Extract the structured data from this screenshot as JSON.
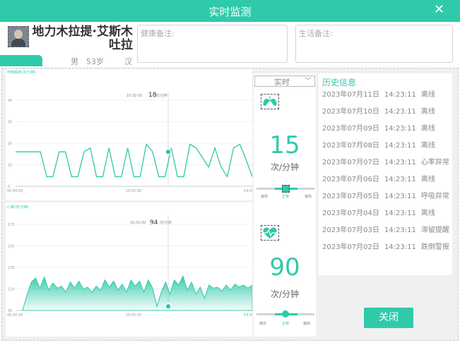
{
  "window": {
    "title": "实时监测"
  },
  "patient": {
    "name": "地力木拉提·艾斯木吐拉",
    "gender": "男",
    "age": "53岁",
    "ethnicity": "汉"
  },
  "notes": {
    "health_label": "健康备注:",
    "life_label": "生活备注:"
  },
  "respiration_chart": {
    "ylabel": "呼吸频率(次/分钟)",
    "y_ticks": [
      "40",
      "30",
      "20",
      "10",
      "0"
    ],
    "x_ticks": [
      "06:00:00",
      "10:00:00",
      "14:00:00"
    ],
    "tooltip_time": "10:32:00",
    "tooltip_value": "18",
    "tooltip_unit": "次/分钟"
  },
  "heart_chart": {
    "ylabel": "心率(次/分钟)",
    "y_ticks": [
      "170",
      "150",
      "130",
      "110",
      "90"
    ],
    "x_ticks": [
      "06:00:00",
      "10:00:00",
      "14:00:00"
    ],
    "tooltip_time": "10:32:00",
    "tooltip_value": "94",
    "tooltip_unit": "次/分钟"
  },
  "chart_data": [
    {
      "type": "line",
      "ylabel": "呼吸频率(次/分钟)",
      "ylim": [
        0,
        45
      ],
      "x": [
        "06:00:00",
        "10:00:00",
        "14:00:00"
      ],
      "values": [
        18,
        18,
        18,
        18,
        18,
        5,
        5,
        18,
        18,
        5,
        5,
        18,
        20,
        5,
        5,
        20,
        5,
        5,
        20,
        5,
        5,
        22,
        18,
        5,
        5,
        20,
        5,
        5,
        22,
        20,
        15,
        10,
        20,
        10,
        5,
        20,
        22,
        14,
        5
      ],
      "highlight": {
        "time": "10:32:00",
        "value": 18
      },
      "color": "#2fcaa9"
    },
    {
      "type": "area",
      "ylabel": "心率(次/分钟)",
      "ylim": [
        90,
        175
      ],
      "x": [
        "06:00:00",
        "10:00:00",
        "14:00:00"
      ],
      "values": [
        90,
        105,
        118,
        122,
        112,
        123,
        110,
        117,
        112,
        114,
        108,
        118,
        112,
        119,
        111,
        113,
        108,
        114,
        110,
        120,
        113,
        119,
        110,
        116,
        108,
        120,
        114,
        119,
        108,
        120,
        112,
        94,
        108,
        118,
        106,
        120,
        115,
        124,
        110,
        118,
        106,
        113,
        102,
        115,
        112,
        113,
        109,
        115,
        110,
        116,
        113,
        115,
        112,
        115
      ],
      "highlight": {
        "time": "10:32:00",
        "value": 94
      },
      "color": "#2fcaa9"
    }
  ],
  "realtime": {
    "mode": "实时",
    "resp_value": "15",
    "resp_unit": "次/分钟",
    "hr_value": "90",
    "hr_unit": "次/分钟",
    "resp_level": 0.5,
    "hr_level": 0.5,
    "level_labels": [
      "偏低",
      "正常",
      "偏高"
    ]
  },
  "history": {
    "title": "历史信息",
    "rows": [
      {
        "date": "2023年07月11日",
        "time": "14:23:11",
        "event": "离线"
      },
      {
        "date": "2023年07月10日",
        "time": "14:23:11",
        "event": "离线"
      },
      {
        "date": "2023年07月09日",
        "time": "14:23:11",
        "event": "离线"
      },
      {
        "date": "2023年07月08日",
        "time": "14:23:11",
        "event": "离线"
      },
      {
        "date": "2023年07月07日",
        "time": "14:23:11",
        "event": "心率异常"
      },
      {
        "date": "2023年07月06日",
        "time": "14:23:11",
        "event": "离线"
      },
      {
        "date": "2023年07月05日",
        "time": "14:23:11",
        "event": "呼吸异常"
      },
      {
        "date": "2023年07月04日",
        "time": "14:23:11",
        "event": "离线"
      },
      {
        "date": "2023年07月03日",
        "time": "14:23:11",
        "event": "滞留提醒"
      },
      {
        "date": "2023年07月02日",
        "time": "14:23:11",
        "event": "跌倒警报"
      }
    ]
  },
  "buttons": {
    "close": "关闭"
  },
  "colors": {
    "accent": "#2fcaa9"
  },
  "icons": {
    "close": "close-icon",
    "lungs": "lungs-icon",
    "heart": "heart-pulse-icon"
  }
}
